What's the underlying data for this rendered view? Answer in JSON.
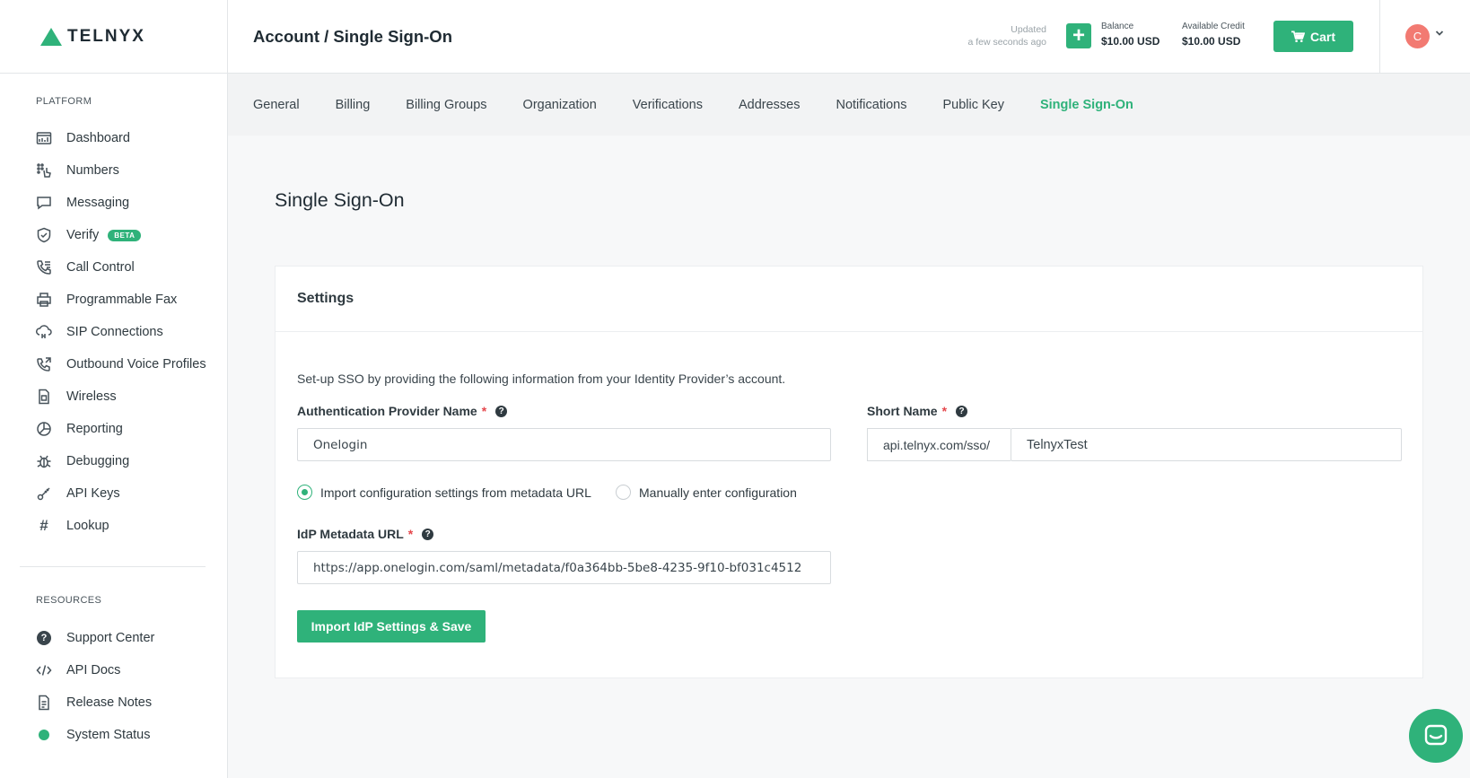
{
  "brand": {
    "name": "TELNYX",
    "accent": "#2fb27a"
  },
  "header": {
    "title": "Account / Single Sign-On",
    "updated_label": "Updated",
    "updated_time": "a few seconds ago",
    "balance_label": "Balance",
    "balance_value": "$10.00 USD",
    "credit_label": "Available Credit",
    "credit_value": "$10.00 USD",
    "cart_label": "Cart",
    "avatar_initial": "C"
  },
  "sidebar": {
    "platform_heading": "PLATFORM",
    "platform_items": [
      {
        "label": "Dashboard",
        "icon": "dashboard-icon"
      },
      {
        "label": "Numbers",
        "icon": "numbers-icon"
      },
      {
        "label": "Messaging",
        "icon": "messaging-icon"
      },
      {
        "label": "Verify",
        "icon": "verify-icon",
        "badge": "BETA"
      },
      {
        "label": "Call Control",
        "icon": "call-control-icon"
      },
      {
        "label": "Programmable Fax",
        "icon": "fax-icon"
      },
      {
        "label": "SIP Connections",
        "icon": "sip-icon"
      },
      {
        "label": "Outbound Voice Profiles",
        "icon": "outbound-voice-icon"
      },
      {
        "label": "Wireless",
        "icon": "wireless-icon"
      },
      {
        "label": "Reporting",
        "icon": "reporting-icon"
      },
      {
        "label": "Debugging",
        "icon": "debugging-icon"
      },
      {
        "label": "API Keys",
        "icon": "api-keys-icon"
      },
      {
        "label": "Lookup",
        "icon": "lookup-icon"
      }
    ],
    "resources_heading": "RESOURCES",
    "resource_items": [
      {
        "label": "Support Center",
        "icon": "help-icon"
      },
      {
        "label": "API Docs",
        "icon": "code-icon"
      },
      {
        "label": "Release Notes",
        "icon": "document-icon"
      },
      {
        "label": "System Status",
        "icon": "status-dot-icon",
        "status_color": "#2fb27a"
      }
    ]
  },
  "tabs": [
    "General",
    "Billing",
    "Billing Groups",
    "Organization",
    "Verifications",
    "Addresses",
    "Notifications",
    "Public Key",
    "Single Sign-On"
  ],
  "active_tab": "Single Sign-On",
  "main": {
    "title": "Single Sign-On",
    "card_title": "Settings",
    "intro": "Set-up SSO by providing the following information from your Identity Provider’s account.",
    "auth_provider_label": "Authentication Provider Name",
    "auth_provider_value": "Onelogin",
    "short_name_label": "Short Name",
    "short_name_prefix": "api.telnyx.com/sso/",
    "short_name_value": "TelnyxTest",
    "radio_import": "Import configuration settings from metadata URL",
    "radio_manual": "Manually enter configuration",
    "selected_radio": "import",
    "metadata_label": "IdP Metadata URL",
    "metadata_value": "https://app.onelogin.com/saml/metadata/f0a364bb-5be8-4235-9f10-bf031c4512",
    "save_button": "Import IdP Settings & Save"
  }
}
